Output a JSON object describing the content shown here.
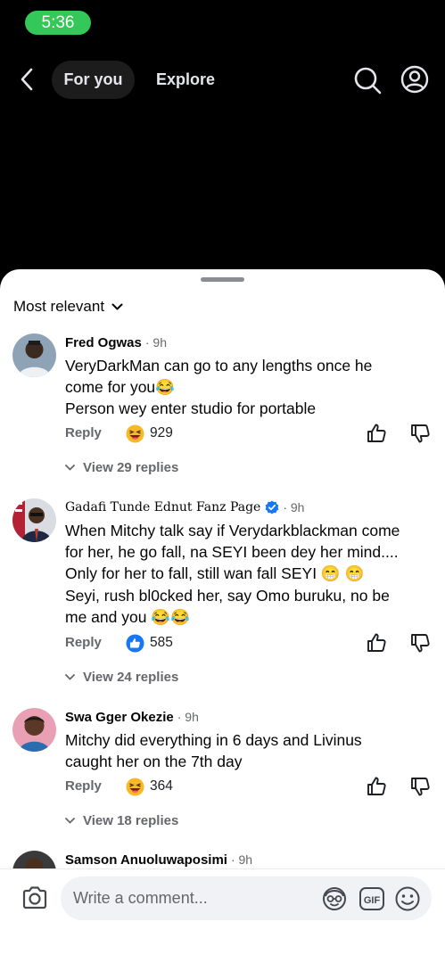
{
  "status_bar": {
    "time": "5:36"
  },
  "header": {
    "tabs": [
      {
        "label": "For you",
        "active": true
      },
      {
        "label": "Explore",
        "active": false
      }
    ],
    "icons": [
      "back-chevron-icon",
      "search-icon",
      "profile-icon"
    ]
  },
  "sheet": {
    "sort_label": "Most relevant",
    "comments": [
      {
        "author": "Fred Ogwas",
        "time": "· 9h",
        "lines": [
          "VeryDarkMan can go to any lengths once he",
          "come for you😂",
          "Person wey enter studio for portable"
        ],
        "reply_label": "Reply",
        "reaction_icon": "laughing-emoji",
        "reaction_count": "929",
        "view_replies": "View 29 replies"
      },
      {
        "author": "Gadafi Tunde Ednut Fanz Page",
        "verified": true,
        "time": "· 9h",
        "lines": [
          "When Mitchy talk say if Verydarkblackman come",
          "for her, he go fall, na SEYI been dey her mind....",
          "Only for her to fall, still wan fall SEYI 😁 😁",
          "Seyi,  rush bl0cked her, say Omo buruku, no be",
          "me and you 😂😂"
        ],
        "reply_label": "Reply",
        "reaction_icon": "like-icon",
        "reaction_count": "585",
        "view_replies": "View 24 replies"
      },
      {
        "author": "Swa Gger Okezie",
        "time": "· 9h",
        "lines": [
          "Mitchy did everything in 6 days and Livinus",
          "caught her on the 7th day"
        ],
        "reply_label": "Reply",
        "reaction_icon": "laughing-emoji",
        "reaction_count": "364",
        "view_replies": "View 18 replies"
      },
      {
        "author": "Samson Anuoluwaposimi",
        "time": "· 9h"
      }
    ]
  },
  "composer": {
    "placeholder": "Write a comment...",
    "gif_label": "GIF",
    "icons": [
      "camera-icon",
      "avatar-sticker-icon",
      "gif-icon",
      "emoji-icon"
    ]
  },
  "colors": {
    "status_pill": "#34c759",
    "link_blue": "#1877f2",
    "muted_text": "#65676b"
  }
}
